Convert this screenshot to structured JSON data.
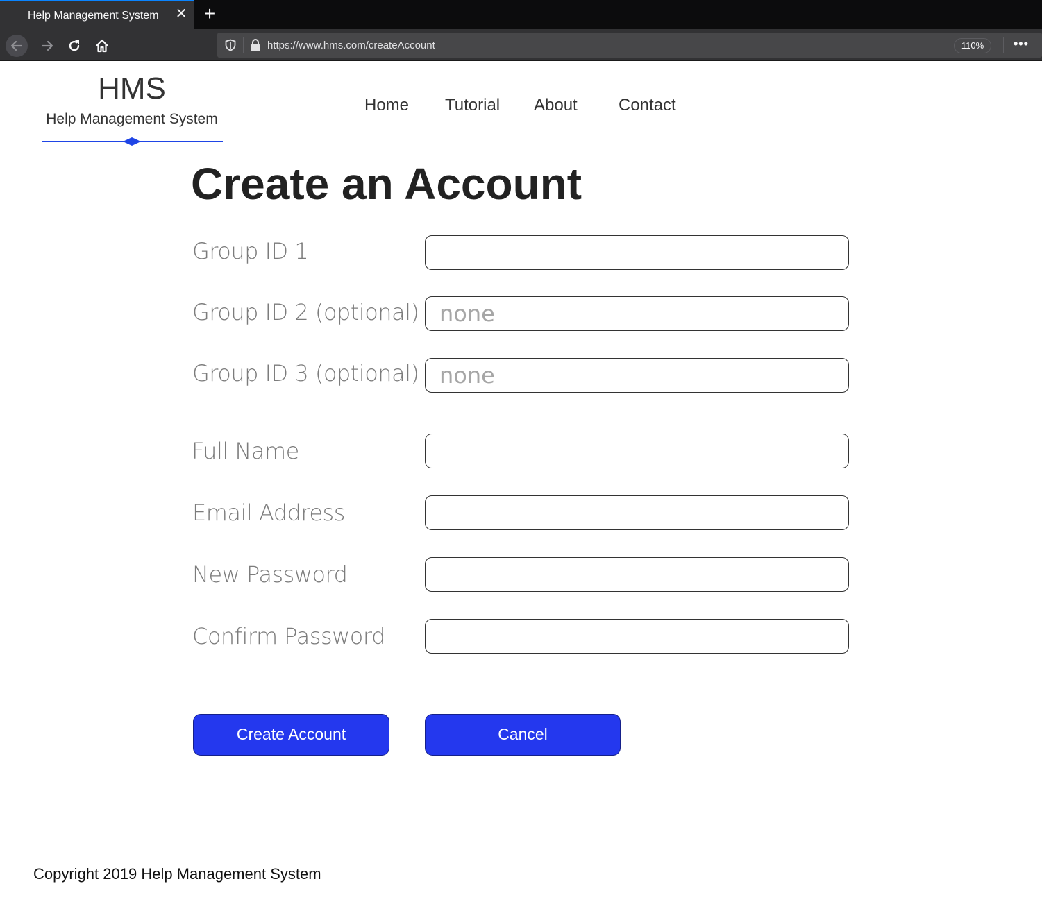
{
  "browser": {
    "tab_title": "Help Management System",
    "url": "https://www.hms.com/createAccount",
    "zoom": "110%"
  },
  "header": {
    "logo_title": "HMS",
    "logo_subtitle": "Help Management System",
    "nav": [
      "Home",
      "Tutorial",
      "About",
      "Contact"
    ]
  },
  "form": {
    "title": "Create an Account",
    "fields": [
      {
        "label": "Group ID 1",
        "placeholder": ""
      },
      {
        "label": "Group ID 2 (optional)",
        "placeholder": "none"
      },
      {
        "label": "Group ID 3 (optional)",
        "placeholder": "none"
      },
      {
        "label": "Full Name",
        "placeholder": ""
      },
      {
        "label": "Email Address",
        "placeholder": ""
      },
      {
        "label": "New Password",
        "placeholder": ""
      },
      {
        "label": "Confirm Password",
        "placeholder": ""
      }
    ],
    "create_label": "Create Account",
    "cancel_label": "Cancel"
  },
  "footer": {
    "copyright": "Copyright 2019 Help Management System"
  },
  "colors": {
    "button_blue": "#2438ee",
    "accent_blue": "#1f45e6"
  }
}
